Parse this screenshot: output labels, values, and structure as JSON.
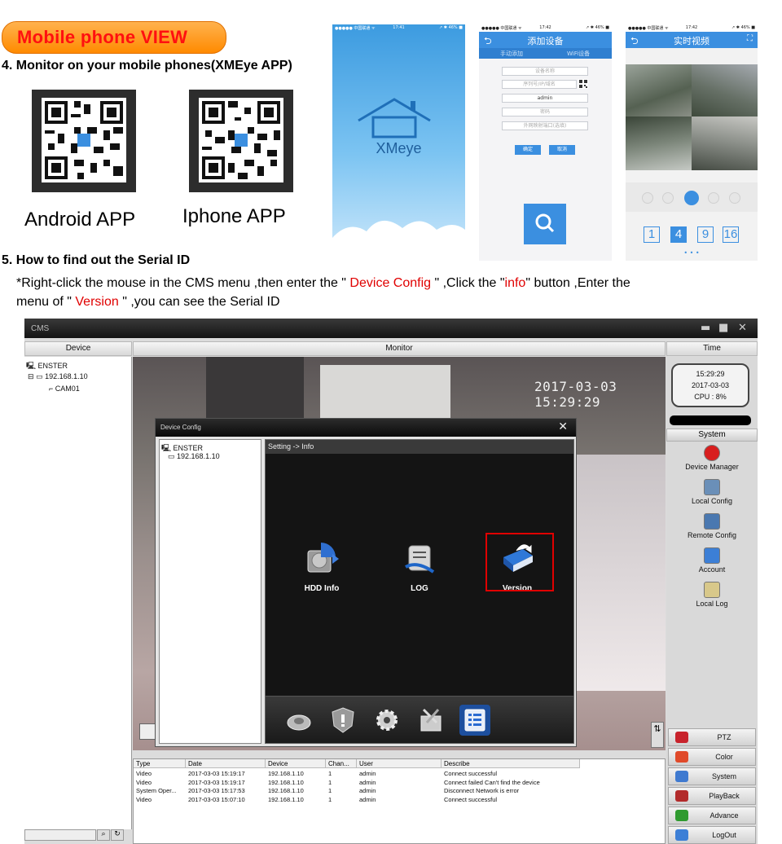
{
  "banner": {
    "label": "Mobile phone VIEW"
  },
  "section4": {
    "heading": "4. Monitor on your mobile phones(XMEye APP)",
    "qr_android_label": "Android APP",
    "qr_iphone_label": "Iphone APP"
  },
  "phone1": {
    "app_name": "XMeye"
  },
  "phone2": {
    "status_left": "●●●●● 中国联通 ᯤ",
    "status_time": "17:42",
    "status_right": "↗ ✱ 46% ■",
    "title": "添加设备",
    "tab_manual": "手动添加",
    "tab_wifi": "WiFi设备",
    "field_device_name": "设备名称",
    "field_serial": "序列号/IP/域名",
    "field_user": "admin",
    "field_password": "密码",
    "field_port": "外网映射端口(选填)",
    "btn_ok": "确定",
    "btn_cancel": "取消"
  },
  "phone1_status": {
    "left": "●●●●● 中国联通 ᯤ",
    "time": "17:41",
    "right": "↗ ✱ 46% ■"
  },
  "phone3": {
    "status_left": "●●●●● 中国联通 ᯤ",
    "status_time": "17:42",
    "status_right": "↗ ✱ 46% ■",
    "title": "实时视频",
    "grid_options": [
      "1",
      "4",
      "9",
      "16"
    ],
    "selected_grid": "4",
    "page_dots": "• • •"
  },
  "section5": {
    "heading": "5. How to find out the Serial ID",
    "line1_a": "*Right-click the mouse in the CMS menu ,then enter the \"",
    "line1_device_config": " Device Config ",
    "line1_b": "\" ,Click the \"",
    "line1_info": "info",
    "line1_c": "\" button ,Enter the",
    "line2_a": "menu of \"",
    "line2_version": " Version ",
    "line2_b": "\" ,you can see the Serial ID"
  },
  "cms": {
    "window_title": "CMS",
    "win_buttons": [
      "▬",
      "■",
      "✕"
    ],
    "col_device": "Device",
    "col_monitor": "Monitor",
    "col_time": "Time",
    "tree": {
      "root": "ENSTER",
      "device": "192.168.1.10",
      "camera": "CAM01"
    },
    "osd_timestamp": "2017-03-03 15:29:29",
    "clock": {
      "time": "15:29:29",
      "date": "2017-03-03",
      "cpu": "CPU : 8%"
    },
    "system_header": "System",
    "system_menu": [
      "Device Manager",
      "Local Config",
      "Remote Config",
      "Account",
      "Local Log"
    ],
    "bottom_buttons": [
      "PTZ",
      "Color",
      "System",
      "PlayBack",
      "Advance",
      "LogOut"
    ],
    "log_headers": [
      "Type",
      "Date",
      "Device",
      "Chan...",
      "User",
      "Describe"
    ],
    "log_rows": [
      [
        "Video",
        "2017-03-03 15:19:17",
        "192.168.1.10",
        "1",
        "admin",
        "Connect successful"
      ],
      [
        "Video",
        "2017-03-03 15:19:17",
        "192.168.1.10",
        "1",
        "admin",
        "Connect failed Can't find the device"
      ],
      [
        "System Oper...",
        "2017-03-03 15:17:53",
        "192.168.1.10",
        "1",
        "admin",
        "Disconnect Network is error"
      ],
      [
        "Video",
        "2017-03-03 15:07:10",
        "192.168.1.10",
        "1",
        "admin",
        "Connect successful"
      ]
    ]
  },
  "dialog": {
    "title": "Device Config",
    "close": "✕",
    "tree_root": "ENSTER",
    "tree_device": "192.168.1.10",
    "breadcrumb": "Setting -> Info",
    "icons": [
      "HDD Info",
      "LOG",
      "Version"
    ],
    "selected_icon": "Version"
  },
  "colors": {
    "accent_red": "#e00000",
    "phone_blue": "#3b8fe0",
    "banner_orange": "#ff8a00"
  }
}
